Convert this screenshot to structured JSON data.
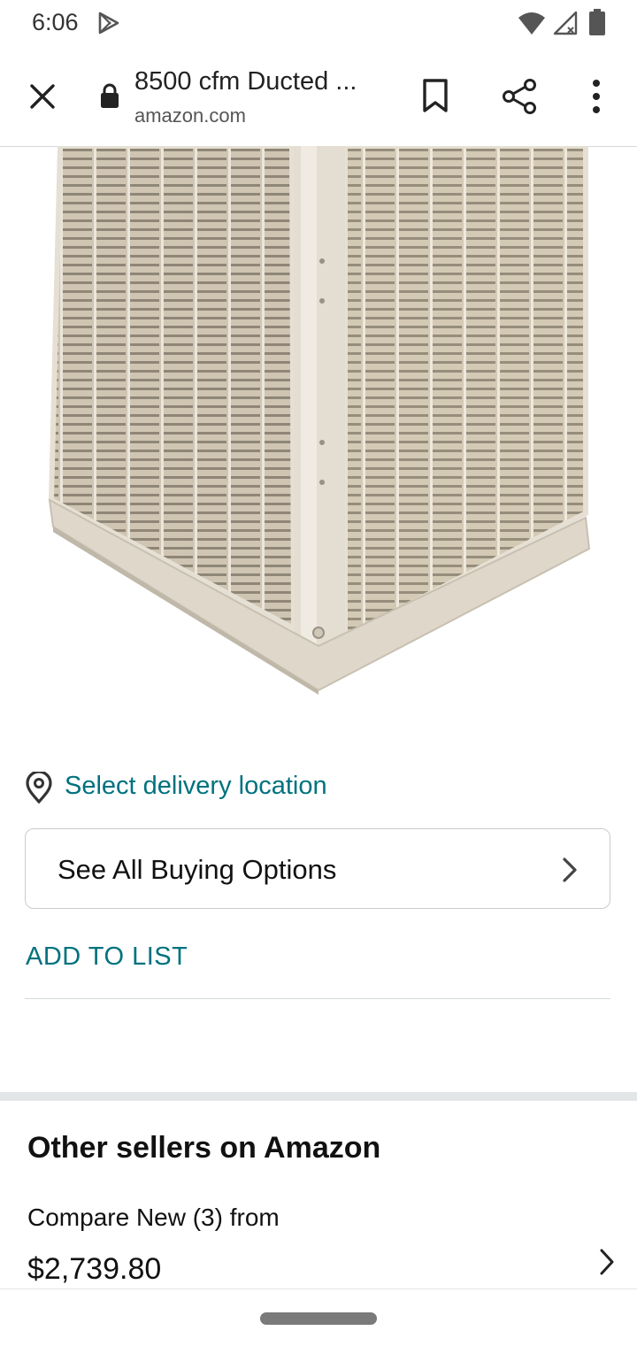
{
  "status_bar": {
    "time": "6:06",
    "icons": [
      "play-store-icon",
      "wifi-icon",
      "signal-icon",
      "battery-icon"
    ]
  },
  "toolbar": {
    "title": "8500 cfm Ducted ...",
    "url": "amazon.com",
    "icons": [
      "close-icon",
      "lock-icon",
      "bookmark-icon",
      "share-icon",
      "more-vert-icon"
    ]
  },
  "product": {
    "image": "product-image"
  },
  "delivery": {
    "label": "Select delivery location",
    "icon": "location-pin-icon"
  },
  "buy_options": {
    "label": "See All Buying Options",
    "icon": "chevron-right-icon"
  },
  "add_to_list": {
    "label": "ADD TO LIST"
  },
  "other_sellers": {
    "heading": "Other sellers on Amazon",
    "compare": "Compare New (3) from",
    "price": "$2,739.80",
    "icon": "chevron-right-icon"
  },
  "colors": {
    "link": "#00727e",
    "divider": "#d5d9d9",
    "band": "#e3e6e6",
    "cooler_body": "#d9d1c3"
  }
}
